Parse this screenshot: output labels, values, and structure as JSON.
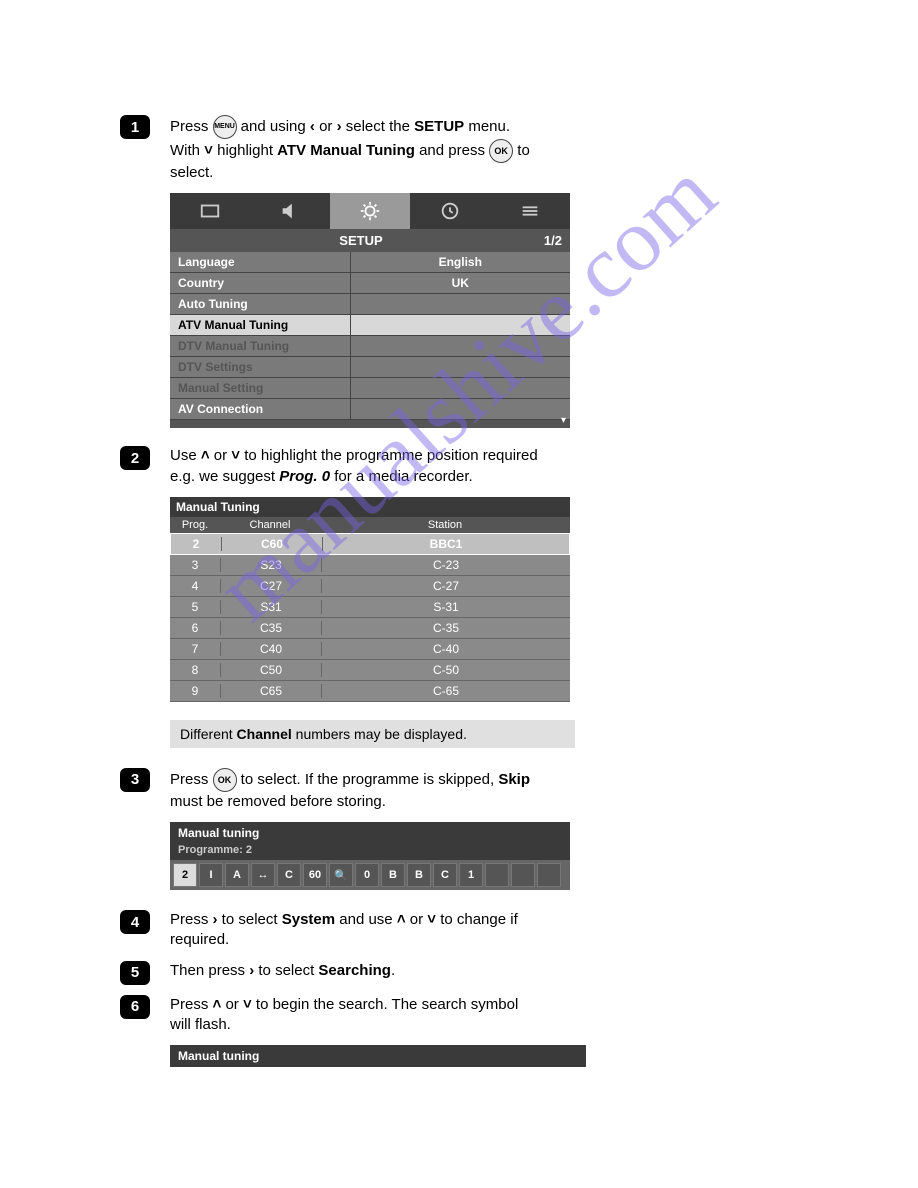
{
  "watermark": "manualshive.com",
  "steps": {
    "s1": {
      "num": "1",
      "t1": "Press ",
      "menu": "MENU",
      "t2": " and using ",
      "lt": "‹",
      "t3": " or ",
      "gt": "›",
      "t4": " select the ",
      "b1": "SETUP",
      "t5": " menu. With ",
      "dn": "˅",
      "t6": " highlight ",
      "b2": "ATV Manual Tuning",
      "t7": " and press ",
      "ok": "OK",
      "t8": " to select."
    },
    "s2": {
      "num": "2",
      "t1": "Use ",
      "up": "˄",
      "t2": " or ",
      "dn": "˅",
      "t3": " to highlight the programme position required e.g. we suggest ",
      "b1": "Prog. 0",
      "t4": " for a media recorder."
    },
    "s3": {
      "num": "3",
      "t1": "Press ",
      "ok": "OK",
      "t2": " to select. If the programme is skipped, ",
      "b1": "Skip",
      "t3": " must be removed before storing."
    },
    "s4": {
      "num": "4",
      "t1": "Press ",
      "gt": "›",
      "t2": " to select ",
      "b1": "System",
      "t3": " and use ",
      "up": "˄",
      "t4": " or ",
      "dn": "˅",
      "t5": " to change if required."
    },
    "s5": {
      "num": "5",
      "t1": "Then press ",
      "gt": "›",
      "t2": " to select ",
      "b1": "Searching",
      "t3": "."
    },
    "s6": {
      "num": "6",
      "t1": "Press ",
      "up": "˄",
      "t2": " or ",
      "dn": "˅",
      "t3": " to begin the search. The search symbol will flash."
    }
  },
  "setup": {
    "title": "SETUP",
    "page": "1/2",
    "rows": [
      {
        "label": "Language",
        "value": "English",
        "cls": ""
      },
      {
        "label": "Country",
        "value": "UK",
        "cls": ""
      },
      {
        "label": "Auto Tuning",
        "value": "",
        "cls": ""
      },
      {
        "label": "ATV Manual Tuning",
        "value": "",
        "cls": "sel"
      },
      {
        "label": "DTV Manual Tuning",
        "value": "",
        "cls": "dim"
      },
      {
        "label": "DTV Settings",
        "value": "",
        "cls": "dim"
      },
      {
        "label": "Manual Setting",
        "value": "",
        "cls": "dim"
      },
      {
        "label": "AV Connection",
        "value": "",
        "cls": ""
      }
    ]
  },
  "mtuning": {
    "title": "Manual Tuning",
    "h1": "Prog.",
    "h2": "Channel",
    "h3": "Station",
    "rows": [
      {
        "p": "2",
        "c": "C60",
        "s": "BBC1",
        "sel": true
      },
      {
        "p": "3",
        "c": "S23",
        "s": "C-23",
        "sel": false
      },
      {
        "p": "4",
        "c": "C27",
        "s": "C-27",
        "sel": false
      },
      {
        "p": "5",
        "c": "S31",
        "s": "S-31",
        "sel": false
      },
      {
        "p": "6",
        "c": "C35",
        "s": "C-35",
        "sel": false
      },
      {
        "p": "7",
        "c": "C40",
        "s": "C-40",
        "sel": false
      },
      {
        "p": "8",
        "c": "C50",
        "s": "C-50",
        "sel": false
      },
      {
        "p": "9",
        "c": "C65",
        "s": "C-65",
        "sel": false
      }
    ]
  },
  "note": {
    "t1": "Different ",
    "b1": "Channel",
    "t2": " numbers may be displayed."
  },
  "progbar": {
    "title": "Manual tuning",
    "sub": "Programme:  2",
    "cells": [
      "2",
      "I",
      "A",
      "↔",
      "C",
      "60",
      "🔍",
      "0",
      "B",
      "B",
      "C",
      "1",
      "",
      "",
      ""
    ]
  },
  "footer_title": "Manual tuning"
}
